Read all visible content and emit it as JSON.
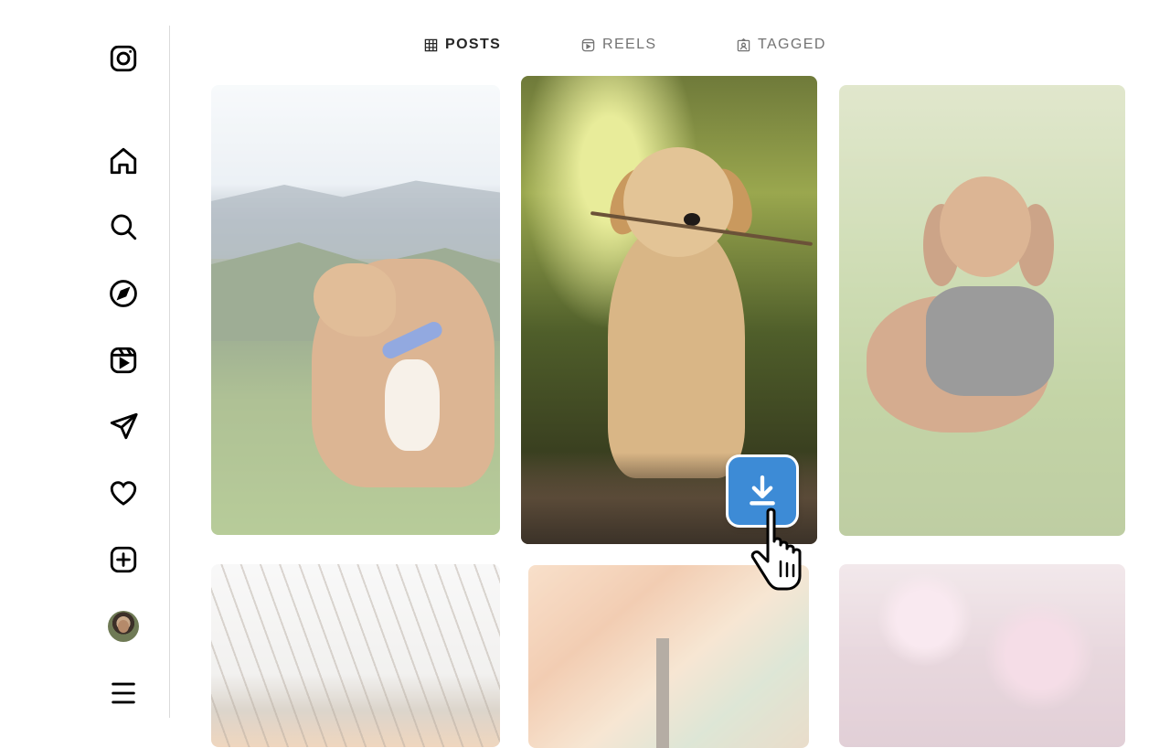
{
  "sidebar": {
    "items": [
      {
        "name": "instagram-logo-icon"
      },
      {
        "name": "home-icon"
      },
      {
        "name": "search-icon"
      },
      {
        "name": "explore-icon"
      },
      {
        "name": "reels-icon"
      },
      {
        "name": "messages-icon"
      },
      {
        "name": "notifications-icon"
      },
      {
        "name": "create-icon"
      },
      {
        "name": "profile-avatar"
      },
      {
        "name": "more-menu-icon"
      }
    ]
  },
  "tabs": [
    {
      "label": "POSTS",
      "icon": "grid-icon",
      "active": true
    },
    {
      "label": "REELS",
      "icon": "reels-icon",
      "active": false
    },
    {
      "label": "TAGGED",
      "icon": "tagged-icon",
      "active": false
    }
  ],
  "posts": [
    {
      "subject": "dog on hillside"
    },
    {
      "subject": "golden retriever puppy"
    },
    {
      "subject": "dachshund in grass"
    },
    {
      "subject": "bare tree branches"
    },
    {
      "subject": "autumn trees"
    },
    {
      "subject": "cherry blossoms"
    }
  ],
  "overlay": {
    "download_button": "download-icon",
    "accent": "#3d8bd6"
  }
}
